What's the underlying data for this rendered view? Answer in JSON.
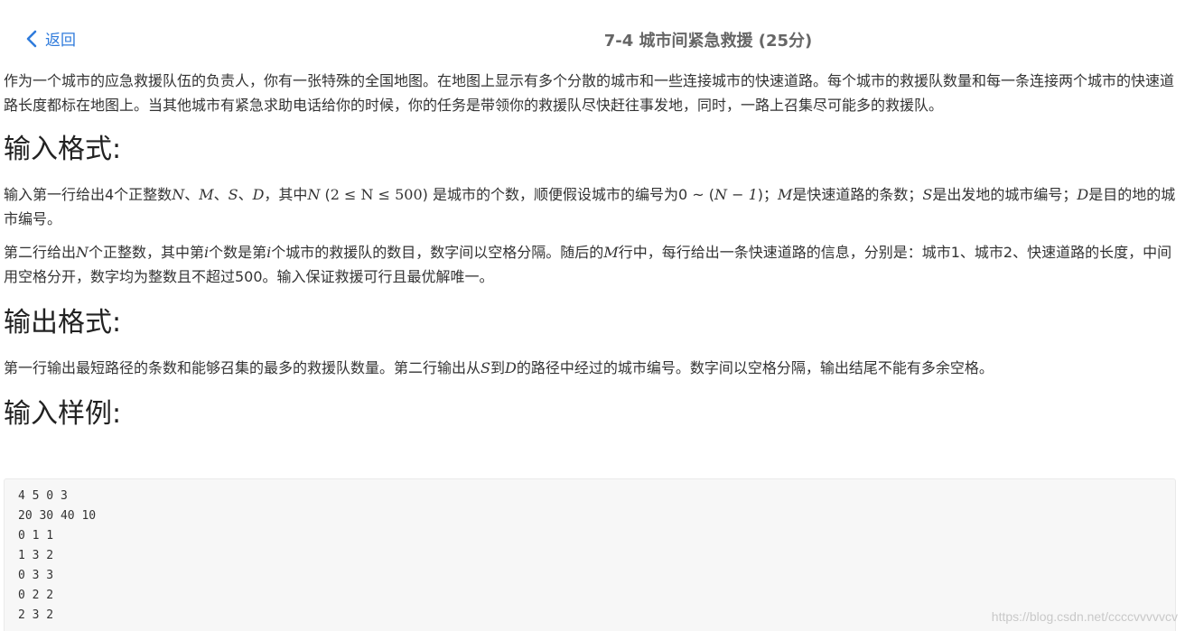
{
  "header": {
    "back_label": "返回",
    "title": "7-4 城市间紧急救援 (25分)"
  },
  "intro": "作为一个城市的应急救援队伍的负责人，你有一张特殊的全国地图。在地图上显示有多个分散的城市和一些连接城市的快速道路。每个城市的救援队数量和每一条连接两个城市的快速道路长度都标在地图上。当其他城市有紧急求助电话给你的时候，你的任务是带领你的救援队尽快赶往事发地，同时，一路上召集尽可能多的救援队。",
  "input_format": {
    "heading": "输入格式:",
    "p1": {
      "t1": "输入第一行给出4个正整数",
      "m1": "N",
      "s1": "、",
      "m2": "M",
      "s2": "、",
      "m3": "S",
      "s3": "、",
      "m4": "D",
      "t2": "，其中",
      "m5": "N",
      "t3": " (",
      "m6": "2 ≤ N ≤ 500",
      "t4": ") 是城市的个数，顺便假设城市的编号为0 ~ (",
      "m7": "N − 1",
      "t5": ")；",
      "m8": "M",
      "t6": "是快速道路的条数；",
      "m9": "S",
      "t7": "是出发地的城市编号；",
      "m10": "D",
      "t8": "是目的地的城市编号。"
    },
    "p2": {
      "t1": "第二行给出",
      "m1": "N",
      "t2": "个正整数，其中第",
      "m2": "i",
      "t3": "个数是第",
      "m3": "i",
      "t4": "个城市的救援队的数目，数字间以空格分隔。随后的",
      "m4": "M",
      "t5": "行中，每行给出一条快速道路的信息，分别是：城市1、城市2、快速道路的长度，中间用空格分开，数字均为整数且不超过500。输入保证救援可行且最优解唯一。"
    }
  },
  "output_format": {
    "heading": "输出格式:",
    "t1": "第一行输出最短路径的条数和能够召集的最多的救援队数量。第二行输出从",
    "m1": "S",
    "t2": "到",
    "m2": "D",
    "t3": "的路径中经过的城市编号。数字间以空格分隔，输出结尾不能有多余空格。"
  },
  "sample": {
    "heading": "输入样例:",
    "lines": [
      "4 5 0 3",
      "20 30 40 10",
      "0 1 1",
      "1 3 2",
      "0 3 3",
      "0 2 2",
      "2 3 2"
    ]
  },
  "watermark": "https://blog.csdn.net/ccccvvvvvcv"
}
